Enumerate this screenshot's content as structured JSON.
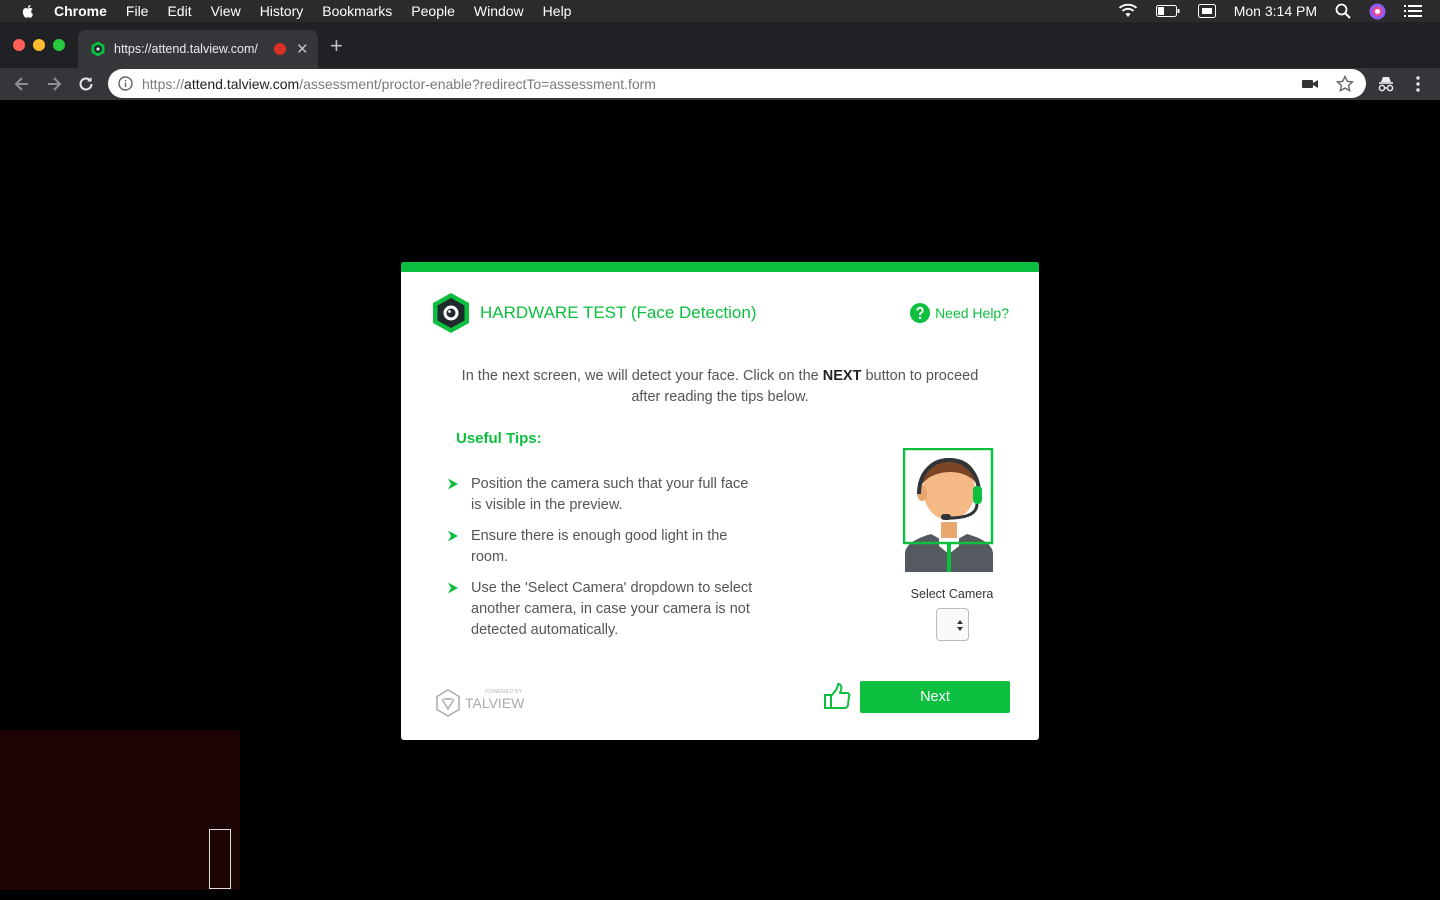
{
  "menubar": {
    "app_name": "Chrome",
    "items": [
      "File",
      "Edit",
      "View",
      "History",
      "Bookmarks",
      "People",
      "Window",
      "Help"
    ],
    "clock": "Mon 3:14 PM"
  },
  "browser": {
    "tab_title": "https://attend.talview.com/",
    "url_scheme": "https://",
    "url_host": "attend.talview.com",
    "url_path": "/assessment/proctor-enable?redirectTo=assessment.form"
  },
  "modal": {
    "title": "HARDWARE TEST (Face Detection)",
    "help_label": "Need Help?",
    "intro_before": "In the next screen, we will detect your face. Click on the ",
    "intro_bold": "NEXT",
    "intro_after": " button to proceed after reading the tips below.",
    "tips_title": "Useful Tips:",
    "tips": [
      "Position the camera such that your full face is visible in the preview.",
      "Ensure there is enough good light in the room.",
      "Use the 'Select Camera' dropdown to select another camera, in case your camera is not detected automatically."
    ],
    "select_camera_label": "Select Camera",
    "powered_by": "POWERED BY",
    "brand": "TALVIEW",
    "next_label": "Next"
  },
  "colors": {
    "accent": "#0cbf3f",
    "chrome_dark": "#202124",
    "chrome_toolbar": "#35363a"
  }
}
